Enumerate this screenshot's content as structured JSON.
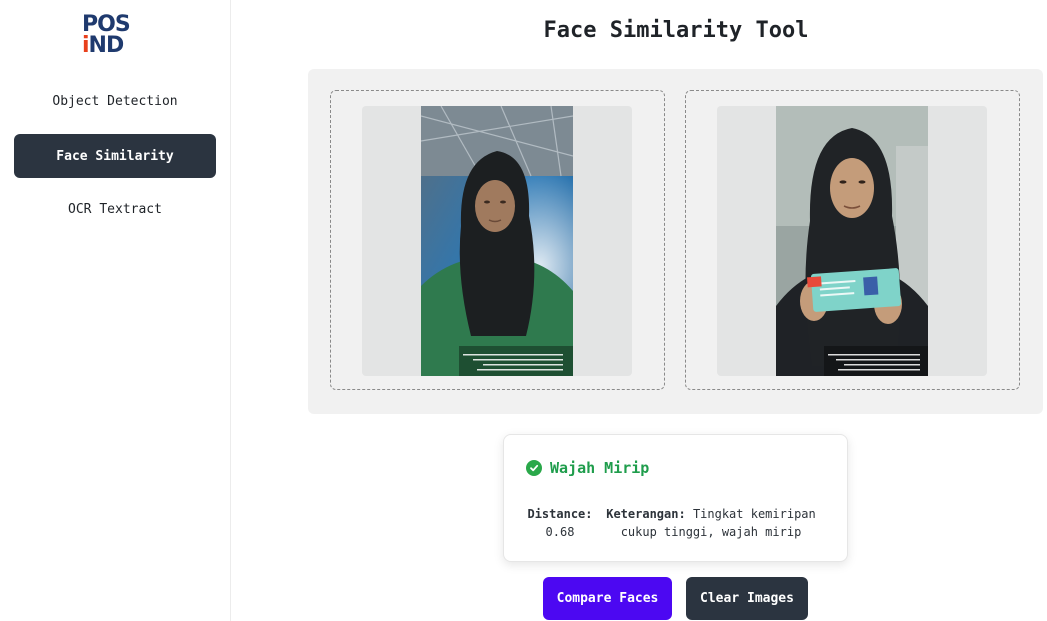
{
  "brand": {
    "logo_line1": "POS",
    "logo_line2_prefix": "i",
    "logo_line2_suffix": "ND"
  },
  "sidebar": {
    "items": [
      {
        "label": "Object Detection",
        "active": false
      },
      {
        "label": "Face Similarity",
        "active": true
      },
      {
        "label": "OCR Textract",
        "active": false
      }
    ]
  },
  "page": {
    "title": "Face Similarity Tool"
  },
  "images": [
    {
      "name": "face-image-1"
    },
    {
      "name": "face-image-2"
    }
  ],
  "result": {
    "icon": "check-circle-icon",
    "title": "Wajah Mirip",
    "distance_label": "Distance:",
    "distance_value": "0.68",
    "note_label": "Keterangan:",
    "note_text_line1": "Tingkat kemiripan",
    "note_text_line2": "cukup tinggi, wajah mirip"
  },
  "buttons": {
    "compare": "Compare Faces",
    "clear": "Clear Images"
  },
  "colors": {
    "sidebar_active": "#2b3440",
    "accent_primary": "#4c08f2",
    "success": "#1f9d4c",
    "brand_blue": "#1f3a6e",
    "brand_orange": "#e8401c"
  }
}
